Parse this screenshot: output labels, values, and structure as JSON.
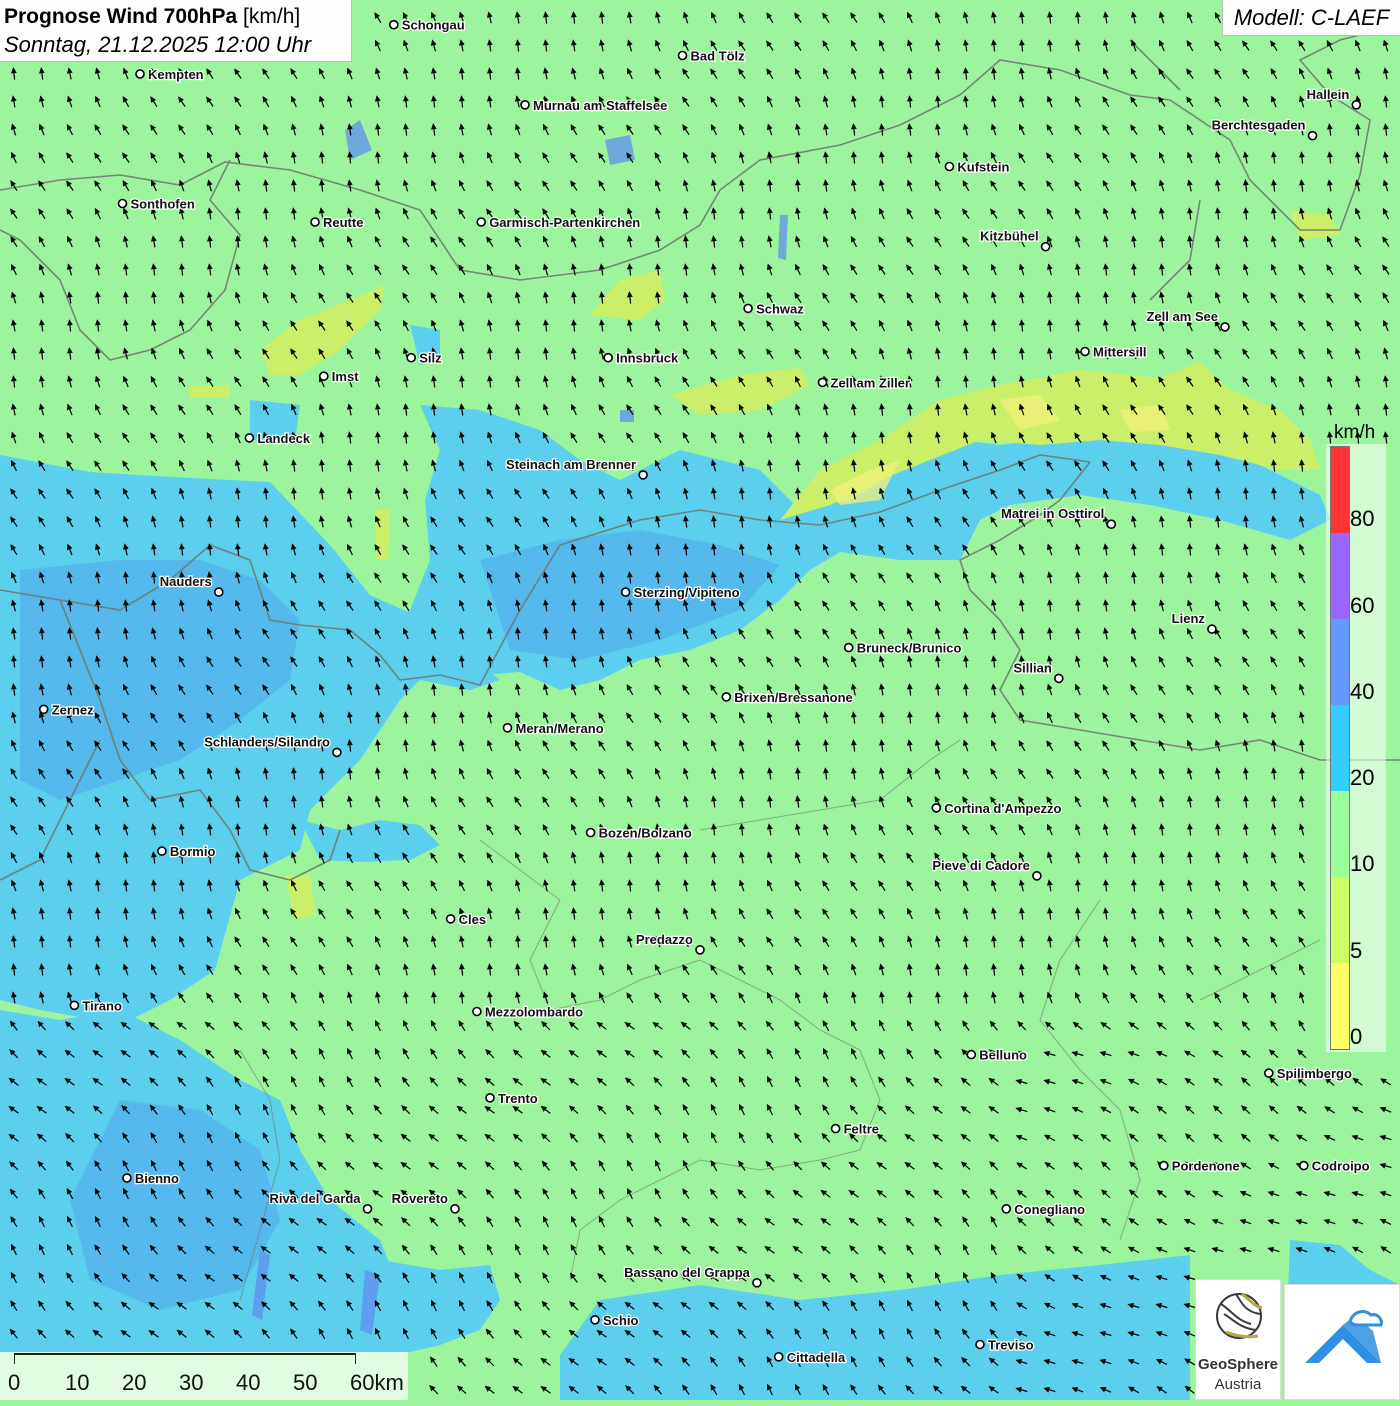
{
  "header": {
    "title_bold": "Prognose Wind 700hPa",
    "title_unit": "[km/h]",
    "datetime": "Sonntag, 21.12.2025 12:00 Uhr"
  },
  "model_label": "Modell: C-LAEF",
  "legend": {
    "unit": "km/h",
    "ticks": [
      "0",
      "5",
      "10",
      "20",
      "40",
      "60",
      "80"
    ],
    "colors": [
      "#ffff66",
      "#ccff66",
      "#99ff99",
      "#33ccff",
      "#6699ff",
      "#9966ff",
      "#ff3333"
    ]
  },
  "scale": {
    "labels": [
      "0",
      "10",
      "20",
      "30",
      "40",
      "50",
      "60km"
    ]
  },
  "logo": {
    "name": "GeoSphere",
    "sub": "Austria"
  },
  "colors": {
    "speed_10_20": "#9cf59c",
    "speed_20_40": "#5ccfee",
    "speed_40_60": "#4f9eea",
    "speed_5_10": "#ccef6a",
    "speed_0_5": "#f2f27a",
    "border": "#6f7a70",
    "lake": "#5f8ff0"
  },
  "cities": [
    {
      "name": "Schongau",
      "lon": 10.9,
      "lat": 47.81
    },
    {
      "name": "Bad Tölz",
      "lon": 11.56,
      "lat": 47.76
    },
    {
      "name": "Kempten",
      "lon": 10.32,
      "lat": 47.73
    },
    {
      "name": "Murnau am Staffelsee",
      "lon": 11.2,
      "lat": 47.68
    },
    {
      "name": "Hallein",
      "lon": 13.1,
      "lat": 47.68
    },
    {
      "name": "Berchtesgaden",
      "lon": 13.0,
      "lat": 47.63
    },
    {
      "name": "Kufstein",
      "lon": 12.17,
      "lat": 47.58
    },
    {
      "name": "Sonthofen",
      "lon": 10.28,
      "lat": 47.52
    },
    {
      "name": "Reutte",
      "lon": 10.72,
      "lat": 47.49
    },
    {
      "name": "Garmisch-Partenkirchen",
      "lon": 11.1,
      "lat": 47.49
    },
    {
      "name": "Kitzbühel",
      "lon": 12.39,
      "lat": 47.45
    },
    {
      "name": "Schwaz",
      "lon": 11.71,
      "lat": 47.35
    },
    {
      "name": "Zell am See",
      "lon": 12.8,
      "lat": 47.32
    },
    {
      "name": "Mittersill",
      "lon": 12.48,
      "lat": 47.28
    },
    {
      "name": "Innsbruck",
      "lon": 11.39,
      "lat": 47.27
    },
    {
      "name": "Silz",
      "lon": 10.94,
      "lat": 47.27
    },
    {
      "name": "Imst",
      "lon": 10.74,
      "lat": 47.24
    },
    {
      "name": "Zell am Ziller",
      "lon": 11.88,
      "lat": 47.23
    },
    {
      "name": "Landeck",
      "lon": 10.57,
      "lat": 47.14
    },
    {
      "name": "Steinach am Brenner",
      "lon": 11.47,
      "lat": 47.08
    },
    {
      "name": "Matrei in Osttirol",
      "lon": 12.54,
      "lat": 47.0
    },
    {
      "name": "Nauders",
      "lon": 10.5,
      "lat": 46.89
    },
    {
      "name": "Sterzing/Vipiteno",
      "lon": 11.43,
      "lat": 46.89
    },
    {
      "name": "Lienz",
      "lon": 12.77,
      "lat": 46.83
    },
    {
      "name": "Bruneck/Brunico",
      "lon": 11.94,
      "lat": 46.8
    },
    {
      "name": "Sillian",
      "lon": 12.42,
      "lat": 46.75
    },
    {
      "name": "Brixen/Bressanone",
      "lon": 11.66,
      "lat": 46.72
    },
    {
      "name": "Zernez",
      "lon": 10.1,
      "lat": 46.7
    },
    {
      "name": "Meran/Merano",
      "lon": 11.16,
      "lat": 46.67
    },
    {
      "name": "Schlanders/Silandro",
      "lon": 10.77,
      "lat": 46.63
    },
    {
      "name": "Cortina d'Ampezzo",
      "lon": 12.14,
      "lat": 46.54
    },
    {
      "name": "Bozen/Bolzano",
      "lon": 11.35,
      "lat": 46.5
    },
    {
      "name": "Bormio",
      "lon": 10.37,
      "lat": 46.47
    },
    {
      "name": "Pieve di Cadore",
      "lon": 12.37,
      "lat": 46.43
    },
    {
      "name": "Cles",
      "lon": 11.03,
      "lat": 46.36
    },
    {
      "name": "Predazzo",
      "lon": 11.6,
      "lat": 46.31
    },
    {
      "name": "Tirano",
      "lon": 10.17,
      "lat": 46.22
    },
    {
      "name": "Mezzolombardo",
      "lon": 11.09,
      "lat": 46.21
    },
    {
      "name": "Belluno",
      "lon": 12.22,
      "lat": 46.14
    },
    {
      "name": "Spilimbergo",
      "lon": 12.9,
      "lat": 46.11
    },
    {
      "name": "Trento",
      "lon": 11.12,
      "lat": 46.07
    },
    {
      "name": "Feltre",
      "lon": 11.91,
      "lat": 46.02
    },
    {
      "name": "Pordenone",
      "lon": 12.66,
      "lat": 45.96
    },
    {
      "name": "Codroipo",
      "lon": 12.98,
      "lat": 45.96
    },
    {
      "name": "Bienno",
      "lon": 10.29,
      "lat": 45.94
    },
    {
      "name": "Riva del Garda",
      "lon": 10.84,
      "lat": 45.89
    },
    {
      "name": "Rovereto",
      "lon": 11.04,
      "lat": 45.89
    },
    {
      "name": "Conegliano",
      "lon": 12.3,
      "lat": 45.89
    },
    {
      "name": "Bassano del Grappa",
      "lon": 11.73,
      "lat": 45.77
    },
    {
      "name": "Schio",
      "lon": 11.36,
      "lat": 45.71
    },
    {
      "name": "Treviso",
      "lon": 12.24,
      "lat": 45.67
    },
    {
      "name": "Cittadella",
      "lon": 11.78,
      "lat": 45.65
    }
  ]
}
